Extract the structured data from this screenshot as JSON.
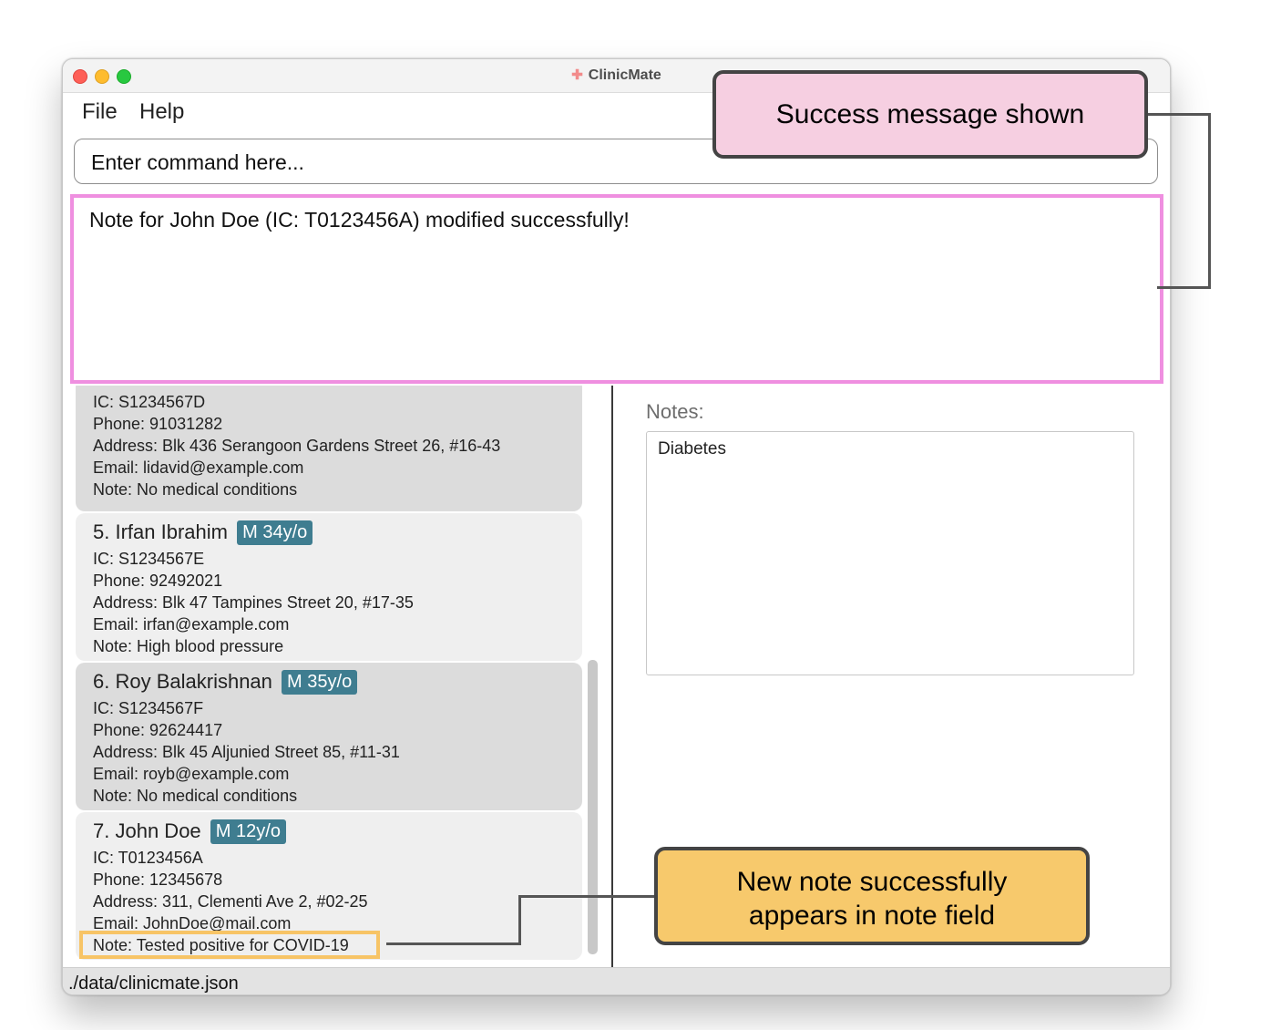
{
  "window": {
    "title": "ClinicMate",
    "app_icon": "plus-cross-icon"
  },
  "menu": {
    "file": "File",
    "help": "Help"
  },
  "command": {
    "placeholder": "Enter command here..."
  },
  "result": {
    "message": "Note for John Doe (IC: T0123456A) modified successfully!"
  },
  "patients": [
    {
      "ic": "IC: S1234567D",
      "phone": "Phone: 91031282",
      "address": "Address: Blk 436 Serangoon Gardens Street 26, #16-43",
      "email": "Email: lidavid@example.com",
      "note": "Note: No medical conditions"
    },
    {
      "index": "5.",
      "name": "Irfan Ibrahim",
      "badge": "M 34y/o",
      "ic": "IC: S1234567E",
      "phone": "Phone: 92492021",
      "address": "Address: Blk 47 Tampines Street 20, #17-35",
      "email": "Email: irfan@example.com",
      "note": "Note: High blood pressure"
    },
    {
      "index": "6.",
      "name": "Roy Balakrishnan",
      "badge": "M 35y/o",
      "ic": "IC: S1234567F",
      "phone": "Phone: 92624417",
      "address": "Address: Blk 45 Aljunied Street 85, #11-31",
      "email": "Email: royb@example.com",
      "note": "Note: No medical conditions"
    },
    {
      "index": "7.",
      "name": "John Doe",
      "badge": "M 12y/o",
      "ic": "IC: T0123456A",
      "phone": "Phone: 12345678",
      "address": "Address: 311, Clementi Ave 2, #02-25",
      "email": "Email: JohnDoe@mail.com",
      "note": "Note: Tested positive for COVID-19"
    }
  ],
  "notes_panel": {
    "label": "Notes:",
    "content": "Diabetes"
  },
  "status": {
    "path": "./data/clinicmate.json"
  },
  "annotations": {
    "success": "Success message shown",
    "note_line1": "New note successfully",
    "note_line2": "appears in note field"
  },
  "colors": {
    "result_border": "#ef8fe0",
    "badge": "#3f7d90",
    "callout_success_bg": "#f6cfe1",
    "callout_note_bg": "#f7c96c",
    "note_highlight": "#f7c466"
  }
}
